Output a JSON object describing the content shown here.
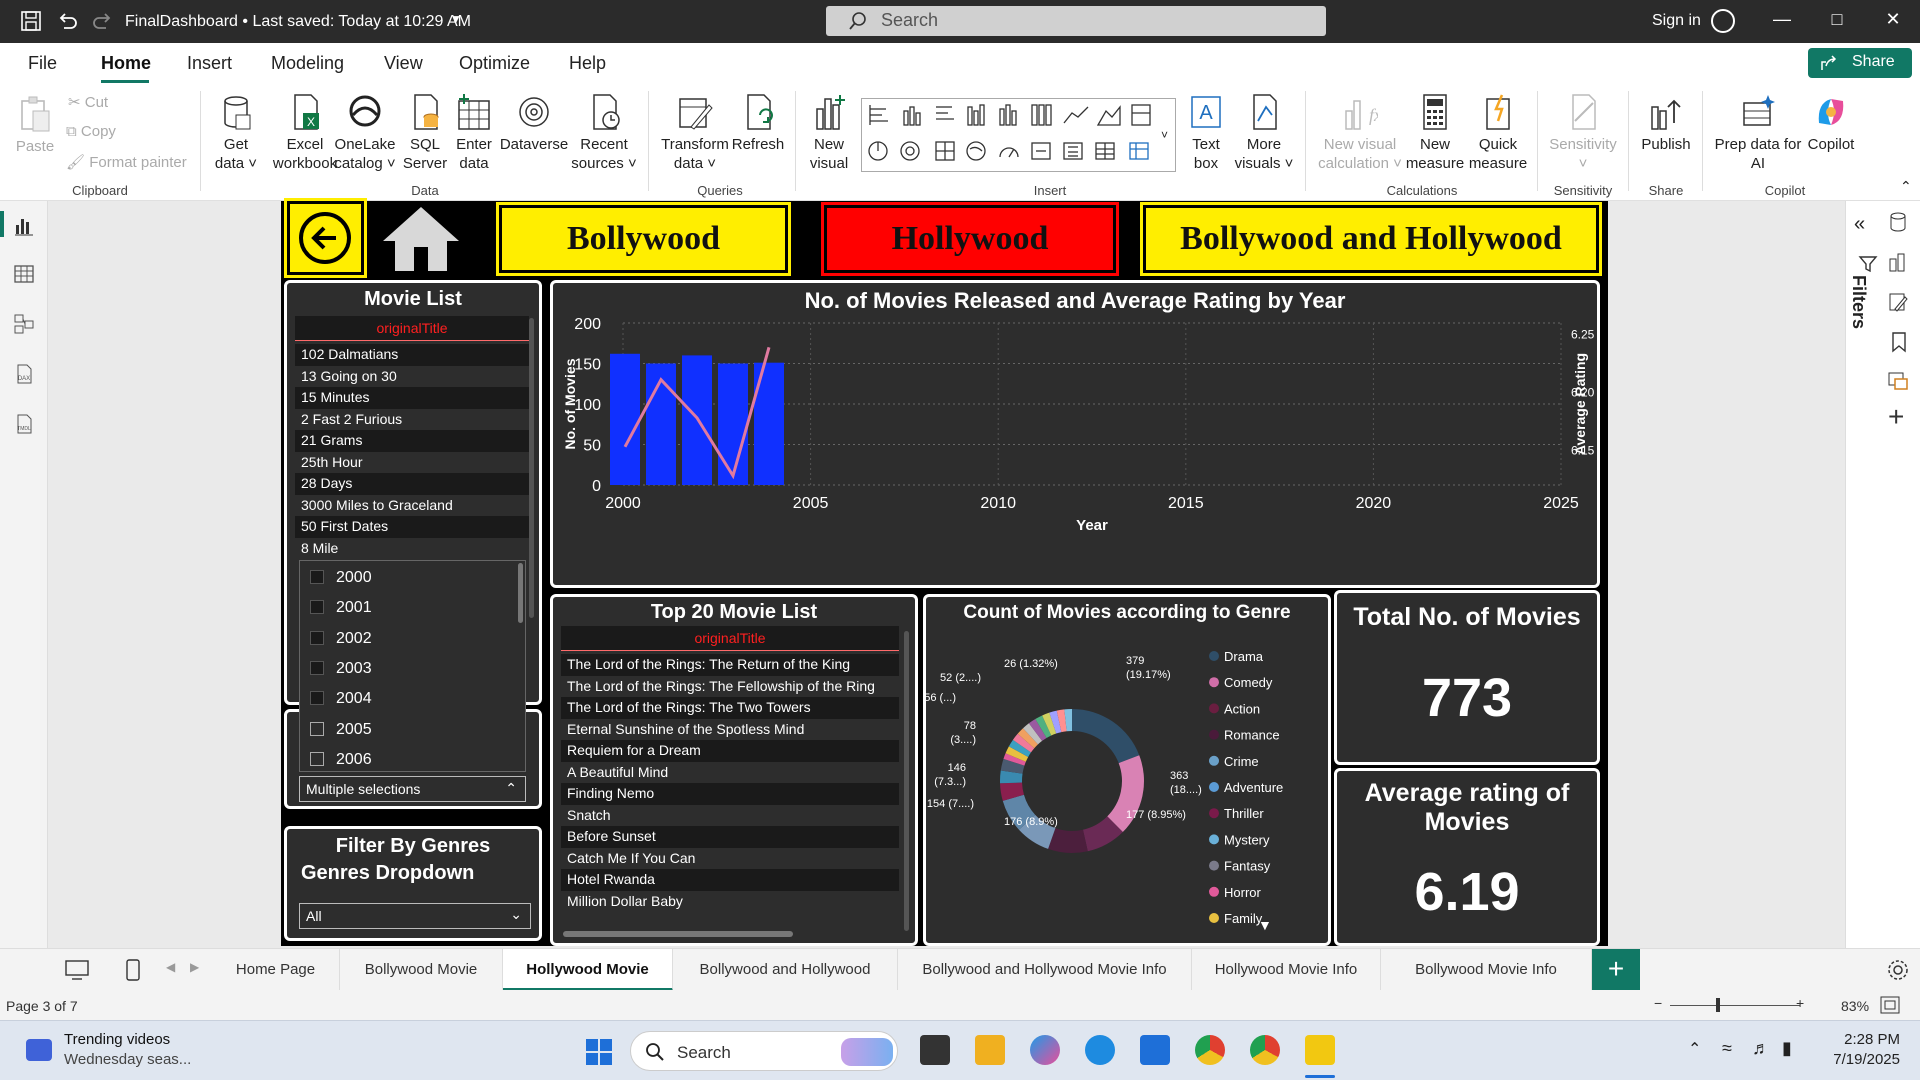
{
  "titlebar": {
    "title": "FinalDashboard • Last saved: Today at 10:29 AM",
    "search_placeholder": "Search",
    "signin": "Sign in"
  },
  "menu": {
    "items": [
      "File",
      "Home",
      "Insert",
      "Modeling",
      "View",
      "Optimize",
      "Help"
    ],
    "active": "Home",
    "share": "Share"
  },
  "ribbon": {
    "clipboard": {
      "paste": "Paste",
      "cut": "Cut",
      "copy": "Copy",
      "format_painter": "Format painter",
      "group": "Clipboard"
    },
    "data": {
      "get_data": [
        "Get",
        "data"
      ],
      "excel": [
        "Excel",
        "workbook"
      ],
      "onelake": [
        "OneLake",
        "catalog"
      ],
      "sql": [
        "SQL",
        "Server"
      ],
      "enter": [
        "Enter",
        "data"
      ],
      "dataverse": [
        "Dataverse",
        ""
      ],
      "recent": [
        "Recent",
        "sources"
      ],
      "group": "Data"
    },
    "queries": {
      "transform": [
        "Transform",
        "data"
      ],
      "refresh": [
        "Refresh",
        ""
      ],
      "group": "Queries"
    },
    "insert": {
      "new_visual": [
        "New",
        "visual"
      ],
      "text_box": [
        "Text",
        "box"
      ],
      "more_visuals": [
        "More",
        "visuals"
      ],
      "group": "Insert"
    },
    "calculations": {
      "new_visual_calc": [
        "New visual",
        "calculation"
      ],
      "new_measure": [
        "New",
        "measure"
      ],
      "quick_measure": [
        "Quick",
        "measure"
      ],
      "group": "Calculations"
    },
    "sensitivity": {
      "label": "Sensitivity",
      "group": "Sensitivity"
    },
    "share": {
      "publish": "Publish",
      "group": "Share"
    },
    "copilot": {
      "prep": [
        "Prep data for",
        "AI"
      ],
      "copilot": [
        "Copilot",
        ""
      ],
      "group": "Copilot"
    }
  },
  "report": {
    "nav": {
      "bollywood": "Bollywood",
      "hollywood": "Hollywood",
      "both": "Bollywood and Hollywood"
    },
    "movie_list": {
      "title": "Movie List",
      "column": "originalTitle",
      "rows": [
        "102 Dalmatians",
        "13 Going on 30",
        "15 Minutes",
        "2 Fast 2 Furious",
        "21 Grams",
        "25th Hour",
        "28 Days",
        "3000 Miles to Graceland",
        "50 First Dates",
        "8 Mile"
      ]
    },
    "year_filter": {
      "options": [
        "2000",
        "2001",
        "2002",
        "2003",
        "2004",
        "2005",
        "2006"
      ],
      "checked": [
        true,
        true,
        true,
        true,
        true,
        false,
        false
      ],
      "selection": "Multiple selections"
    },
    "genre_filter": {
      "title": "Filter By Genres",
      "subtitle": "Genres Dropdown",
      "selection": "All"
    },
    "top20": {
      "title": "Top 20 Movie List",
      "column": "originalTitle",
      "rows": [
        "The Lord of the Rings: The Return of the King",
        "The Lord of the Rings: The Fellowship of the Ring",
        "The Lord of the Rings: The Two Towers",
        "Eternal Sunshine of the Spotless Mind",
        "Requiem for a Dream",
        "A Beautiful Mind",
        "Finding Nemo",
        "Snatch",
        "Before Sunset",
        "Catch Me If You Can",
        "Hotel Rwanda",
        "Million Dollar Baby"
      ]
    },
    "genre_chart_title": "Count of Movies according to Genre",
    "total_card": {
      "title": "Total No. of Movies",
      "value": "773"
    },
    "rating_card": {
      "title": "Average rating of Movies",
      "value": "6.19"
    }
  },
  "chart_data": [
    {
      "type": "bar",
      "title": "No. of Movies Released and Average Rating by Year",
      "xlabel": "Year",
      "ylabel": "No. of Movies",
      "y2label": "Average Rating",
      "x": [
        2000,
        2001,
        2002,
        2003,
        2004
      ],
      "series": [
        {
          "values": [
            162,
            150,
            160,
            150,
            151
          ],
          "color": "#1030ff"
        },
        {
          "values": [
            6.153,
            6.211,
            6.178,
            6.128,
            6.239
          ],
          "color": "#e07aa0",
          "axis": "secondary",
          "type": "line"
        }
      ],
      "xlim": [
        2000,
        2025
      ],
      "xticks": [
        2000,
        2005,
        2010,
        2015,
        2020,
        2025
      ],
      "ylim": [
        0,
        200
      ],
      "yticks": [
        0,
        50,
        100,
        150,
        200
      ],
      "y2ticks": [
        "6.15",
        "6.20",
        "6.25"
      ],
      "y2lim": [
        6.12,
        6.26
      ]
    },
    {
      "type": "pie",
      "title": "Count of Movies according to Genre",
      "categories": [
        "Drama",
        "Comedy",
        "Action",
        "Romance",
        "Crime",
        "Adventure",
        "Thriller",
        "Mystery",
        "Fantasy",
        "Horror",
        "Family"
      ],
      "legend_colors": [
        "#2f4e68",
        "#d06ea8",
        "#6a1e40",
        "#4a1a3a",
        "#6aa0c8",
        "#5b9bd5",
        "#7a1a4a",
        "#6ab0d8",
        "#7a7a8a",
        "#e05a9a",
        "#e8c040"
      ],
      "values": [
        379,
        363,
        177,
        176,
        154,
        146,
        78,
        56,
        52,
        26
      ],
      "data_labels": [
        "379 (19.17%)",
        "363 (18....)",
        "177 (8.95%)",
        "176 (8.9%)",
        "154 (7....)",
        "146 (7.3...)",
        "78 (3....)",
        "56 (...)",
        "52 (2....)",
        "26 (1.32%)"
      ],
      "slice_colors": [
        "#2f4e68",
        "#d982b4",
        "#6a2a55",
        "#4c1f3d",
        "#7a98b8",
        "#5f86a8",
        "#8a1f4e",
        "#3a8ab0",
        "#4a5a70",
        "#e05a9a",
        "#e8c040",
        "#3aa0c0",
        "#f07a9a",
        "#f0a060",
        "#c0c0c0",
        "#9a5aa0",
        "#50b080",
        "#d0d060",
        "#a0a0ff",
        "#ff9090",
        "#80c0e0"
      ],
      "legend": "right"
    }
  ],
  "tabs": [
    "Home Page",
    "Bollywood Movie",
    "Hollywood Movie",
    "Bollywood and Hollywood",
    "Bollywood and Hollywood Movie Info",
    "Hollywood Movie Info",
    "Bollywood Movie Info"
  ],
  "active_tab": "Hollywood Movie",
  "status": {
    "page": "Page 3 of 7",
    "zoom": "83%"
  },
  "taskbar": {
    "news_title": "Trending videos",
    "news_sub": "Wednesday seas...",
    "search": "Search",
    "time": "2:28 PM",
    "date": "7/19/2025"
  }
}
